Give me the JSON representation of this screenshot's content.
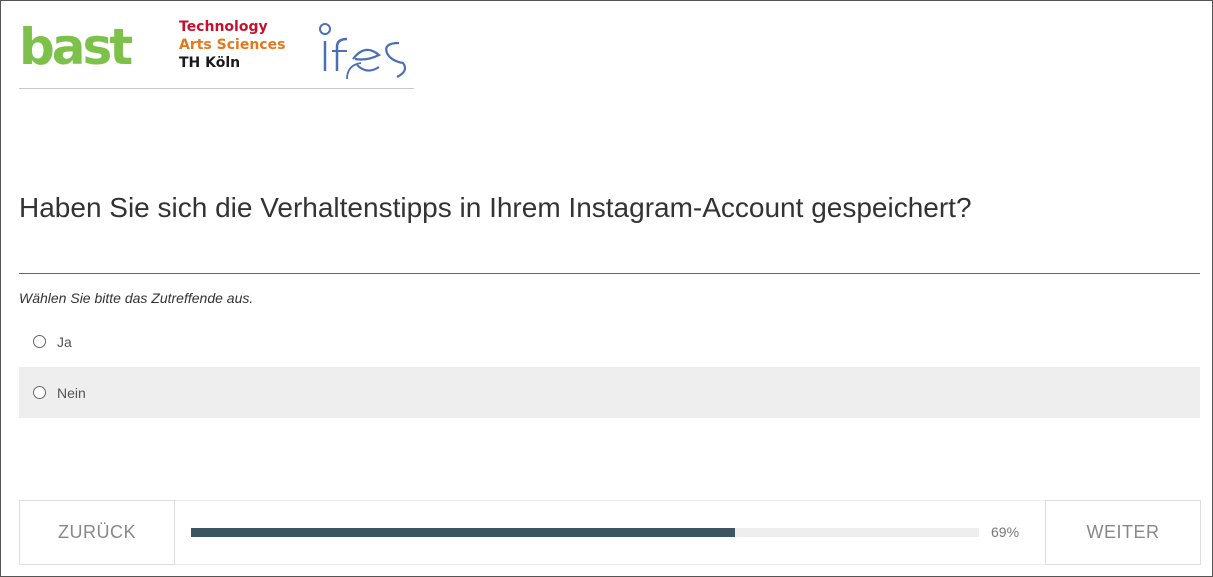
{
  "header": {
    "logo_bast": "bast",
    "logo_th_line1": "Technology",
    "logo_th_line2": "Arts Sciences",
    "logo_th_line3": "TH Köln",
    "logo_ifes": "ifes"
  },
  "question": {
    "title": "Haben Sie sich die Verhaltenstipps in Ihrem Instagram-Account gespeichert?",
    "help": "Wählen Sie bitte das Zutreffende aus.",
    "options": [
      {
        "label": "Ja",
        "selected": false
      },
      {
        "label": "Nein",
        "selected": false
      }
    ]
  },
  "navigation": {
    "back_label": "ZURÜCK",
    "next_label": "WEITER",
    "progress_percent": 69,
    "progress_label": "69%"
  },
  "colors": {
    "bast_green": "#7dc14a",
    "th_red": "#c8102e",
    "th_orange": "#e5781b",
    "progress_fill": "#3b5562",
    "ifes_blue": "#4a6fb5"
  }
}
